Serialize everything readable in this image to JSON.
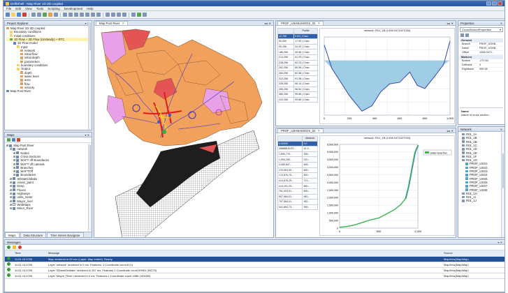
{
  "window": {
    "title": "DelftShell - Map River 1D-2D coupled"
  },
  "menu": [
    "File",
    "Edit",
    "View",
    "Tools",
    "Scripting",
    "Development",
    "Help"
  ],
  "project": {
    "title": "Project Explorer",
    "items": [
      {
        "label": "Map River 1D-2D coupled",
        "indent": 0,
        "color": "#d2a54a"
      },
      {
        "label": "Boundary conditions",
        "indent": 1,
        "color": "#f3d26b"
      },
      {
        "label": "Initial conditions",
        "indent": 1,
        "color": "#f3d26b"
      },
      {
        "label": "1D Flow + 2D Flow (Unsteady) + RTC",
        "indent": 1,
        "color": "#5ca85a",
        "highlight": true
      },
      {
        "label": "1D Flow model",
        "indent": 2,
        "color": "#5b86c4"
      },
      {
        "label": "Input",
        "indent": 3,
        "color": "#f3d26b"
      },
      {
        "label": "network",
        "indent": 4,
        "color": "#e69d55"
      },
      {
        "label": "initial flow",
        "indent": 4,
        "color": "#e69d55"
      },
      {
        "label": "initial depth",
        "indent": 4,
        "color": "#e69d55"
      },
      {
        "label": "parameters",
        "indent": 4,
        "color": "#e69d55"
      },
      {
        "label": "boundary conditions",
        "indent": 3,
        "color": "#f3d26b"
      },
      {
        "label": "Output",
        "indent": 3,
        "color": "#f3d26b"
      },
      {
        "label": "depth",
        "indent": 4,
        "color": "#e69d55"
      },
      {
        "label": "water level",
        "indent": 4,
        "color": "#e69d55"
      },
      {
        "label": "area",
        "indent": 4,
        "color": "#e69d55"
      },
      {
        "label": "flow",
        "indent": 4,
        "color": "#e69d55"
      },
      {
        "label": "velocity",
        "indent": 4,
        "color": "#e69d55"
      },
      {
        "label": "Map Post River",
        "indent": 0,
        "color": "#5b86c4"
      }
    ]
  },
  "maps": {
    "title": "Maps",
    "items": [
      {
        "label": "Map Post River",
        "indent": 0,
        "checked": true
      },
      {
        "label": "network",
        "indent": 1,
        "checked": true
      },
      {
        "label": "Nodes",
        "indent": 2,
        "checked": true
      },
      {
        "label": "Cross Sections",
        "indent": 2,
        "checked": true
      },
      {
        "label": "WAFT off Boundaries",
        "indent": 2,
        "checked": true
      },
      {
        "label": "WAFT off Laterals",
        "indent": 2,
        "checked": true
      },
      {
        "label": "Branches",
        "indent": 2,
        "checked": true
      },
      {
        "label": "WAFTOff",
        "indent": 2,
        "checked": true
      },
      {
        "label": "Boundaries",
        "indent": 2,
        "checked": true
      },
      {
        "label": "SDstatGridlake",
        "indent": 1,
        "checked": true
      },
      {
        "label": "ocean_paint",
        "indent": 1,
        "checked": true
      },
      {
        "label": "Deep",
        "indent": 1,
        "checked": true
      },
      {
        "label": "Fluxes",
        "indent": 1,
        "checked": true
      },
      {
        "label": "Highways",
        "indent": 1,
        "checked": true
      },
      {
        "label": "units_meter",
        "indent": 1,
        "checked": true
      },
      {
        "label": "Mayor_river",
        "indent": 1,
        "checked": true
      },
      {
        "label": "WebMaps",
        "indent": 1,
        "checked": false
      },
      {
        "label": "Minor_River",
        "indent": 1,
        "checked": true
      }
    ],
    "bottom_tabs": [
      "Maps",
      "Data Structure",
      "Time Series Navigator"
    ]
  },
  "map_view": {
    "tab": "Map Post River"
  },
  "cross_section": {
    "tab": "PROF_USHBAMOOS_02",
    "chart_title": "network: R01_1B (1498.0471927034)",
    "table": {
      "headers": [
        "",
        "Profile"
      ],
      "rows": [
        [
          "12,766",
          "0.00 | Chan"
        ],
        [
          "50,000",
          "17.00 | Chan"
        ],
        [
          "95,256",
          "24.20 | Chan"
        ],
        [
          "186,256",
          "35.58 | Chan"
        ],
        [
          "214,256",
          "41.29 | Chan"
        ],
        [
          "238,256",
          "52.23 | Chan"
        ],
        [
          "262,256",
          "80.58 | Chan"
        ],
        [
          "284,256",
          "82.58 | Chan"
        ],
        [
          "312,256",
          "91.38 | Chan"
        ],
        [
          "336,256",
          "96.14 | Chan"
        ],
        [
          "350,256",
          "98.64 | Chan"
        ],
        [
          "380,256",
          "99.86 | Chan"
        ],
        [
          "410,256",
          "99.86 | Chan"
        ]
      ]
    },
    "xticks": [
      "0",
      "200",
      "400",
      "600",
      "800",
      "1,000"
    ]
  },
  "timeseries": {
    "tab": "PROF_USHBAMOOS_02",
    "chart_title": "network: R01_1B (1498.0471927034)",
    "legend": "water level flux",
    "table": {
      "headers": [
        "",
        "distance"
      ],
      "rows": [
        [
          "0.00000",
          "0.0"
        ],
        [
          "288888.8133...",
          "41.3..."
        ],
        [
          "1,890,779...",
          "189..."
        ],
        [
          "1,900,290...",
          "220..."
        ],
        [
          "3,083,847...",
          "489..."
        ],
        [
          "270,063,09...",
          "460..."
        ],
        [
          "172,876,75...",
          "500..."
        ],
        [
          "414,876,29...",
          "713..."
        ],
        [
          "414,291,29...",
          "850..."
        ],
        [
          "781,003,01...",
          "890..."
        ],
        [
          "907,564,01...",
          "940..."
        ],
        [
          "797,564,01...",
          "952..."
        ],
        [
          "941,894,73...",
          "990..."
        ]
      ]
    },
    "yticks": [
      "5,500,000",
      "5,000,000",
      "4,500,000",
      "4,000,000",
      "3,500,000",
      "3,000,000",
      "2,500,000",
      "2,000,000",
      "1,500,000",
      "1,000,000",
      "500,000",
      "0"
    ],
    "xticks": [
      "0",
      "500",
      "1,000"
    ]
  },
  "properties": {
    "title": "Properties",
    "selector": "CrossSectionProperties",
    "sections": [
      {
        "name": "General",
        "rows": [
          [
            "Branch",
            "PROF_USHB..."
          ],
          [
            "Name",
            "PROF_USHB..."
          ],
          [
            "Offset",
            "1498.0471..."
          ]
        ]
      },
      {
        "name": "Markers",
        "rows": [
          [
            "Bottom",
            "-272.64"
          ],
          [
            "Leftbank",
            "0"
          ],
          [
            "Rightbank",
            "999.28"
          ]
        ]
      }
    ],
    "help_title": "Name",
    "help_text": "Name of cross section."
  },
  "network": {
    "title": "Network",
    "items": [
      "R01_1A",
      "R01_1B",
      "R01_1B",
      "R01_1C",
      "R01_1D",
      "R01_1E",
      "R01_1F",
      "R01_1G",
      "PROF_USS1",
      "PROF_USS2",
      "PROF_USS3",
      "PROF_USS4",
      "PROF_USS5",
      "PROF_USS6",
      "PROF_USS7",
      "PROF_USS8",
      "R01_1H",
      "R01_1I",
      "R01_1J"
    ]
  },
  "messages": {
    "title": "Messages",
    "headers": [
      "Time",
      "Message",
      "Source"
    ],
    "rows": [
      {
        "time": "11:51:13.5700",
        "message": "Map rendered in 00 sec (Layer: Map extent). Ready.",
        "source": "MapView(Map/Map)",
        "selected": true
      },
      {
        "time": "11:51:13.5700",
        "message": "Layer 'network' rendered in 0 ms. Features: 1 Coordinate count 8 (1)",
        "source": "MapView(Map/Map)"
      },
      {
        "time": "11:51:13.5700",
        "message": "Layer 'SDstatGridlake' rendered in 257 ms. Features 1 Coordinate count 59951 (50279)",
        "source": "MapView(Map/Map)"
      },
      {
        "time": "11:51:13.5700",
        "message": "Layer 'Mayor_River' rendered in 0 ms. Features 1 Coordinate count 4386 (153000)",
        "source": "MapView(Map/Map)"
      }
    ]
  }
}
